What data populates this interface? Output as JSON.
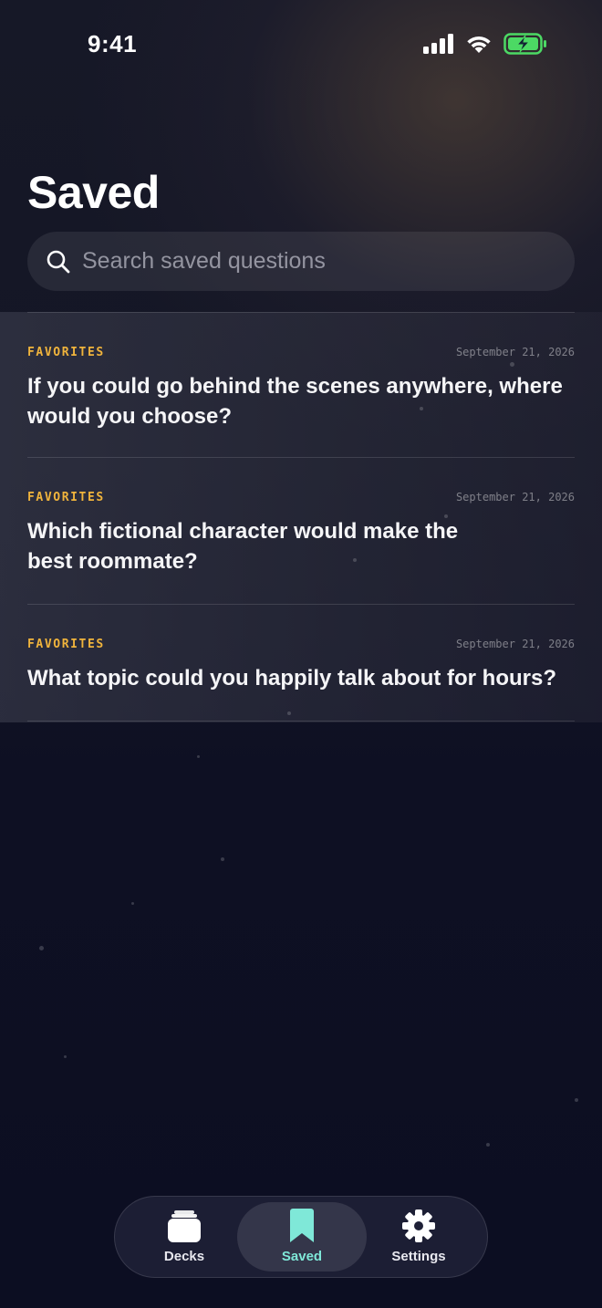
{
  "status": {
    "time": "9:41"
  },
  "header": {
    "title": "Saved"
  },
  "search": {
    "placeholder": "Search saved questions"
  },
  "saved": [
    {
      "deck": "FAVORITES",
      "date": "September 21, 2026",
      "question": "If you could go behind the scenes anywhere, where would you choose?"
    },
    {
      "deck": "FAVORITES",
      "date": "September 21, 2026",
      "question": "Which fictional character would make the best roommate?"
    },
    {
      "deck": "FAVORITES",
      "date": "September 21, 2026",
      "question": "What topic could you happily talk about for hours?"
    }
  ],
  "tabbar": {
    "tabs": [
      {
        "label": "Decks",
        "icon": "cards-stack-icon",
        "active": false
      },
      {
        "label": "Saved",
        "icon": "bookmark-icon",
        "active": true
      },
      {
        "label": "Settings",
        "icon": "gear-icon",
        "active": false
      }
    ]
  },
  "colors": {
    "accent_tag": "#f0b43c",
    "active_tab": "#7fe8d8",
    "battery": "#4cd964",
    "background": "#0d0f22"
  }
}
